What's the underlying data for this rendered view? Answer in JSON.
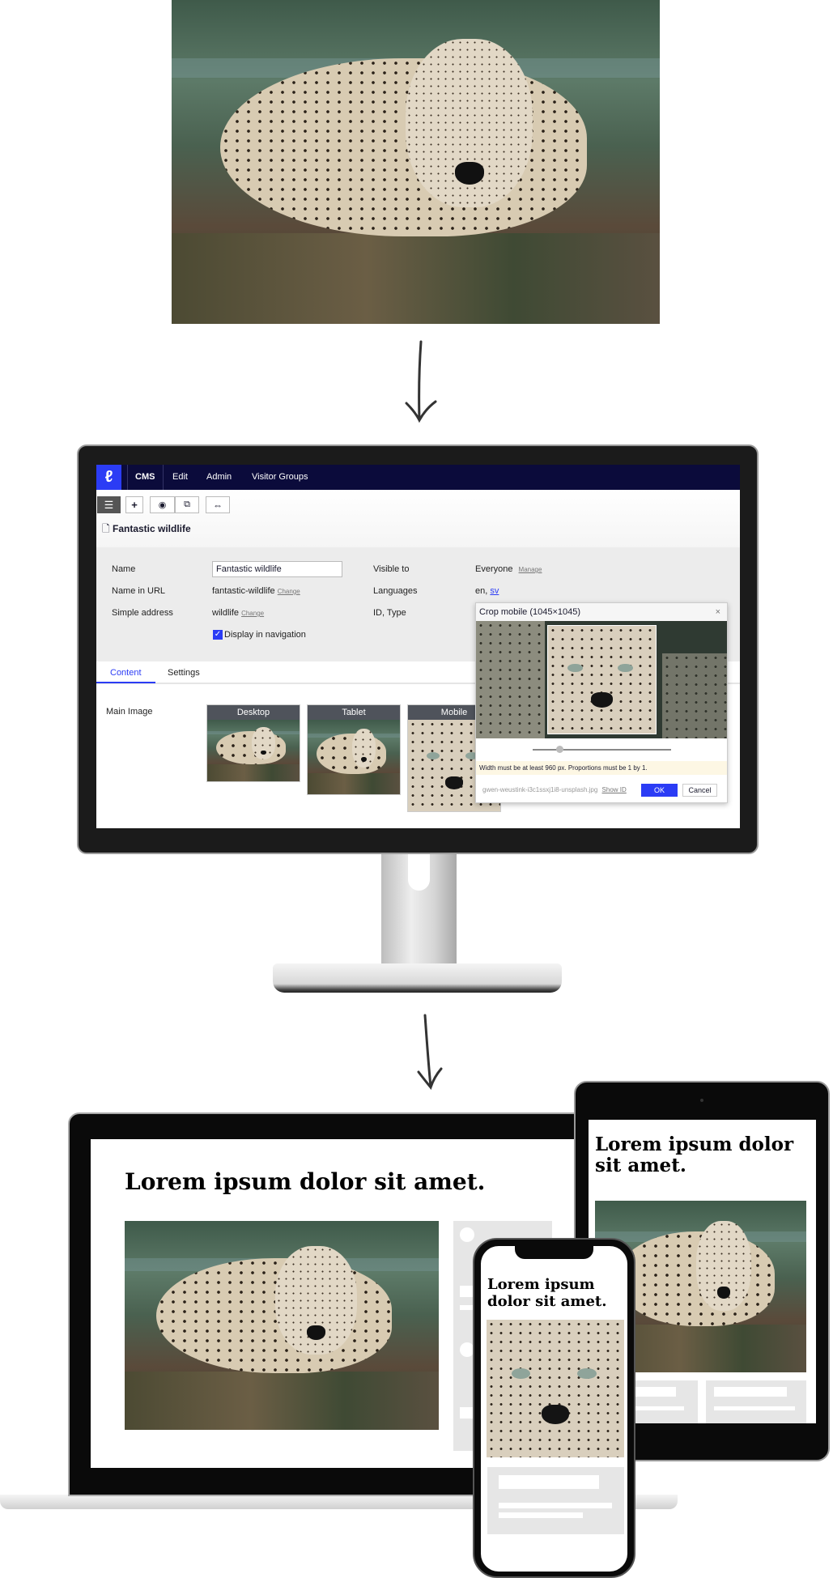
{
  "cms": {
    "nav": {
      "brand": "CMS",
      "items": [
        "Edit",
        "Admin",
        "Visitor Groups"
      ]
    },
    "toolbar": {
      "icons": [
        "tree-icon",
        "plus-icon",
        "eye-icon",
        "preview-icon",
        "compare-icon"
      ],
      "plus": "+",
      "eye": "👁",
      "preview": "🔍",
      "compare": "⇔"
    },
    "page_title": "Fantastic wildlife",
    "fields": {
      "name_label": "Name",
      "name_value": "Fantastic wildlife",
      "url_label": "Name in URL",
      "url_value": "fantastic-wildlife",
      "url_change": "Change",
      "simple_label": "Simple address",
      "simple_value": "wildlife",
      "simple_change": "Change",
      "nav_checkbox": "Display in navigation",
      "nav_checked": true,
      "visible_label": "Visible to",
      "visible_value": "Everyone",
      "visible_manage": "Manage",
      "lang_label": "Languages",
      "lang_value": "en,",
      "lang_link": "sv",
      "id_label": "ID, Type"
    },
    "tabs": [
      "Content",
      "Settings"
    ],
    "active_tab": "Content",
    "main_image_label": "Main Image",
    "thumbs": [
      "Desktop",
      "Tablet",
      "Mobile"
    ],
    "crop_dialog": {
      "title": "Crop mobile (1045×1045)",
      "close": "×",
      "warning": "Width must be at least 960 px. Proportions must be 1 by 1.",
      "filename": "gwen-weustink-i3c1ssxj1i8-unsplash.jpg",
      "show_id": "Show ID",
      "ok": "OK",
      "cancel": "Cancel",
      "zoom_level": 0.17
    },
    "colors": {
      "nav_bg": "#0b0b3b",
      "accent": "#2b3cf5",
      "logo": "#2b3cf5",
      "warning_bg": "#fdf7e4"
    }
  },
  "preview": {
    "laptop_heading": "Lorem ipsum dolor sit amet.",
    "tablet_heading": "Lorem ipsum dolor sit amet.",
    "phone_heading": "Lorem ipsum dolor sit amet."
  }
}
